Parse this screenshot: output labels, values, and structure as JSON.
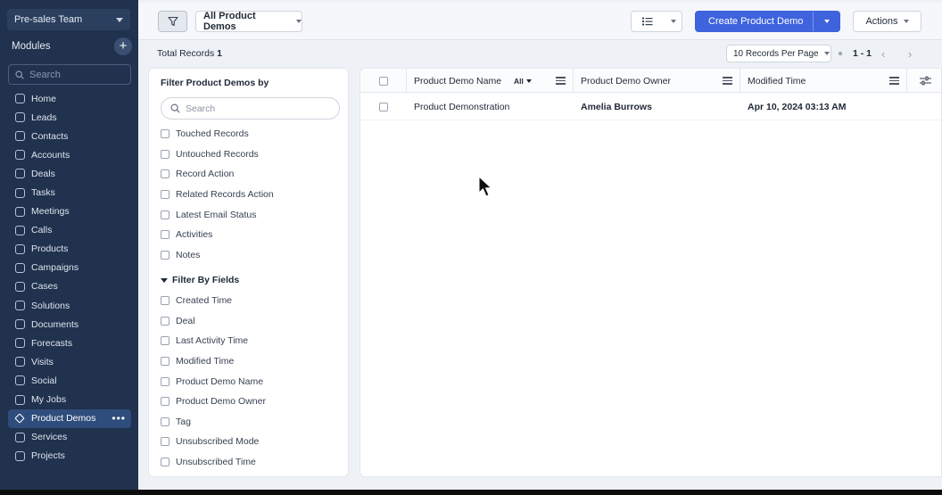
{
  "sidebar": {
    "team": "Pre-sales Team",
    "modules_label": "Modules",
    "add_label": "+",
    "search_placeholder": "Search",
    "items": [
      {
        "label": "Home",
        "icon": "home-icon"
      },
      {
        "label": "Leads",
        "icon": "leads-icon"
      },
      {
        "label": "Contacts",
        "icon": "contacts-icon"
      },
      {
        "label": "Accounts",
        "icon": "accounts-icon"
      },
      {
        "label": "Deals",
        "icon": "deals-icon"
      },
      {
        "label": "Tasks",
        "icon": "tasks-icon"
      },
      {
        "label": "Meetings",
        "icon": "meetings-icon"
      },
      {
        "label": "Calls",
        "icon": "calls-icon"
      },
      {
        "label": "Products",
        "icon": "products-icon"
      },
      {
        "label": "Campaigns",
        "icon": "campaigns-icon"
      },
      {
        "label": "Cases",
        "icon": "cases-icon"
      },
      {
        "label": "Solutions",
        "icon": "solutions-icon"
      },
      {
        "label": "Documents",
        "icon": "documents-icon"
      },
      {
        "label": "Forecasts",
        "icon": "forecasts-icon"
      },
      {
        "label": "Visits",
        "icon": "visits-icon"
      },
      {
        "label": "Social",
        "icon": "social-icon"
      },
      {
        "label": "My Jobs",
        "icon": "my-jobs-icon"
      },
      {
        "label": "Product Demos",
        "icon": "product-demos-icon",
        "active": true
      },
      {
        "label": "Services",
        "icon": "services-icon"
      },
      {
        "label": "Projects",
        "icon": "projects-icon"
      }
    ],
    "more_label": "•••"
  },
  "toolbar": {
    "view": "All Product Demos",
    "create_label": "Create Product Demo",
    "actions_label": "Actions"
  },
  "records": {
    "total_label": "Total Records",
    "total": "1",
    "per_page": "10 Records Per Page",
    "range": "1 - 1",
    "prev": "‹",
    "next": "›"
  },
  "filter_panel": {
    "title": "Filter Product Demos by",
    "search_placeholder": "Search",
    "system_filters": [
      "Touched Records",
      "Untouched Records",
      "Record Action",
      "Related Records Action",
      "Latest Email Status",
      "Activities",
      "Notes"
    ],
    "fields_title": "Filter By Fields",
    "fields": [
      "Created Time",
      "Deal",
      "Last Activity Time",
      "Modified Time",
      "Product Demo Name",
      "Product Demo Owner",
      "Tag",
      "Unsubscribed Mode",
      "Unsubscribed Time"
    ]
  },
  "table": {
    "columns": {
      "name": "Product Demo Name",
      "name_filter": "All",
      "owner": "Product Demo Owner",
      "modified": "Modified Time"
    },
    "rows": [
      {
        "name": "Product Demonstration",
        "owner": "Amelia Burrows",
        "modified": "Apr 10, 2024 03:13 AM"
      }
    ]
  },
  "colors": {
    "sidebar_bg": "#20324e",
    "accent": "#3e63dd",
    "main_bg": "#eef1f6"
  }
}
